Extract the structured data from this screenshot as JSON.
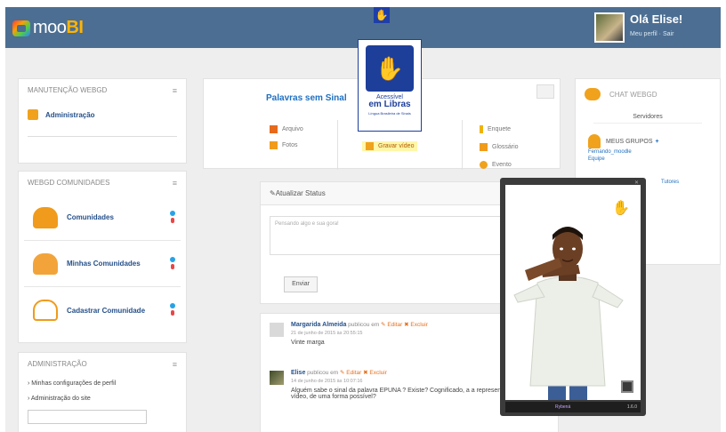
{
  "header": {
    "logo_prefix": "moo",
    "logo_suffix": "BI",
    "user_greeting": "Olá Elise!",
    "user_links": "Meu perfil · Sair",
    "top_access_icon": "sign-language-icon"
  },
  "left": {
    "manutencao": {
      "title": "MANUTENÇÃO WEBGD",
      "items": [
        "Administração"
      ]
    },
    "comunidades": {
      "title": "WEBGD COMUNIDADES",
      "items": [
        "Comunidades",
        "Minhas Comunidades",
        "Cadastrar Comunidade"
      ]
    },
    "administracao": {
      "title": "ADMINISTRAÇÃO",
      "links": [
        "Minhas configurações de perfil",
        "Administração do site"
      ]
    }
  },
  "center": {
    "title": "Palavras sem Sinal",
    "actions": {
      "arquivo": "Arquivo",
      "fotos": "Fotos",
      "video": "Gravar vídeo",
      "enquete": "Enquete",
      "glossario": "Glossário",
      "evento": "Evento"
    },
    "status": {
      "title": "Atualizar Status",
      "placeholder": "Pensando algo e sua gora!",
      "button": "Enviar"
    },
    "feed": [
      {
        "author": "Margarida Almeida",
        "meta": " publicou em ",
        "like": "Editar",
        "remove": "Excluir",
        "date": "21 de junho de 2015 às 20:55:15",
        "text": "Vinte marga"
      },
      {
        "author": "Elise",
        "meta": " publicou em ",
        "like": "Editar",
        "remove": "Excluir",
        "date": "14 de junho de 2015 às 10:07:16",
        "text": "Alguém sabe o sinal da palavra EPUNA ? Existe? Cognificado, a a representação, com vídeo, de uma forma possível?"
      }
    ]
  },
  "chat": {
    "title": "CHAT WEBGD",
    "search": "Servidores",
    "groups_label": "MEUS GRUPOS",
    "groups_plus": "+",
    "group_items": [
      "Fernando_moodle",
      "Equipe",
      "Tutores"
    ]
  },
  "access_badge": {
    "line1": "Acessível",
    "line2": "em Libras",
    "line3": "Língua Brasileira de Sinais"
  },
  "signer": {
    "brand": "Rybená",
    "version": "1.6.0"
  },
  "colors": {
    "topbar": "#4c6e92",
    "link": "#25508a",
    "accent": "#f0a21d",
    "access_blue": "#1d3f9a"
  }
}
